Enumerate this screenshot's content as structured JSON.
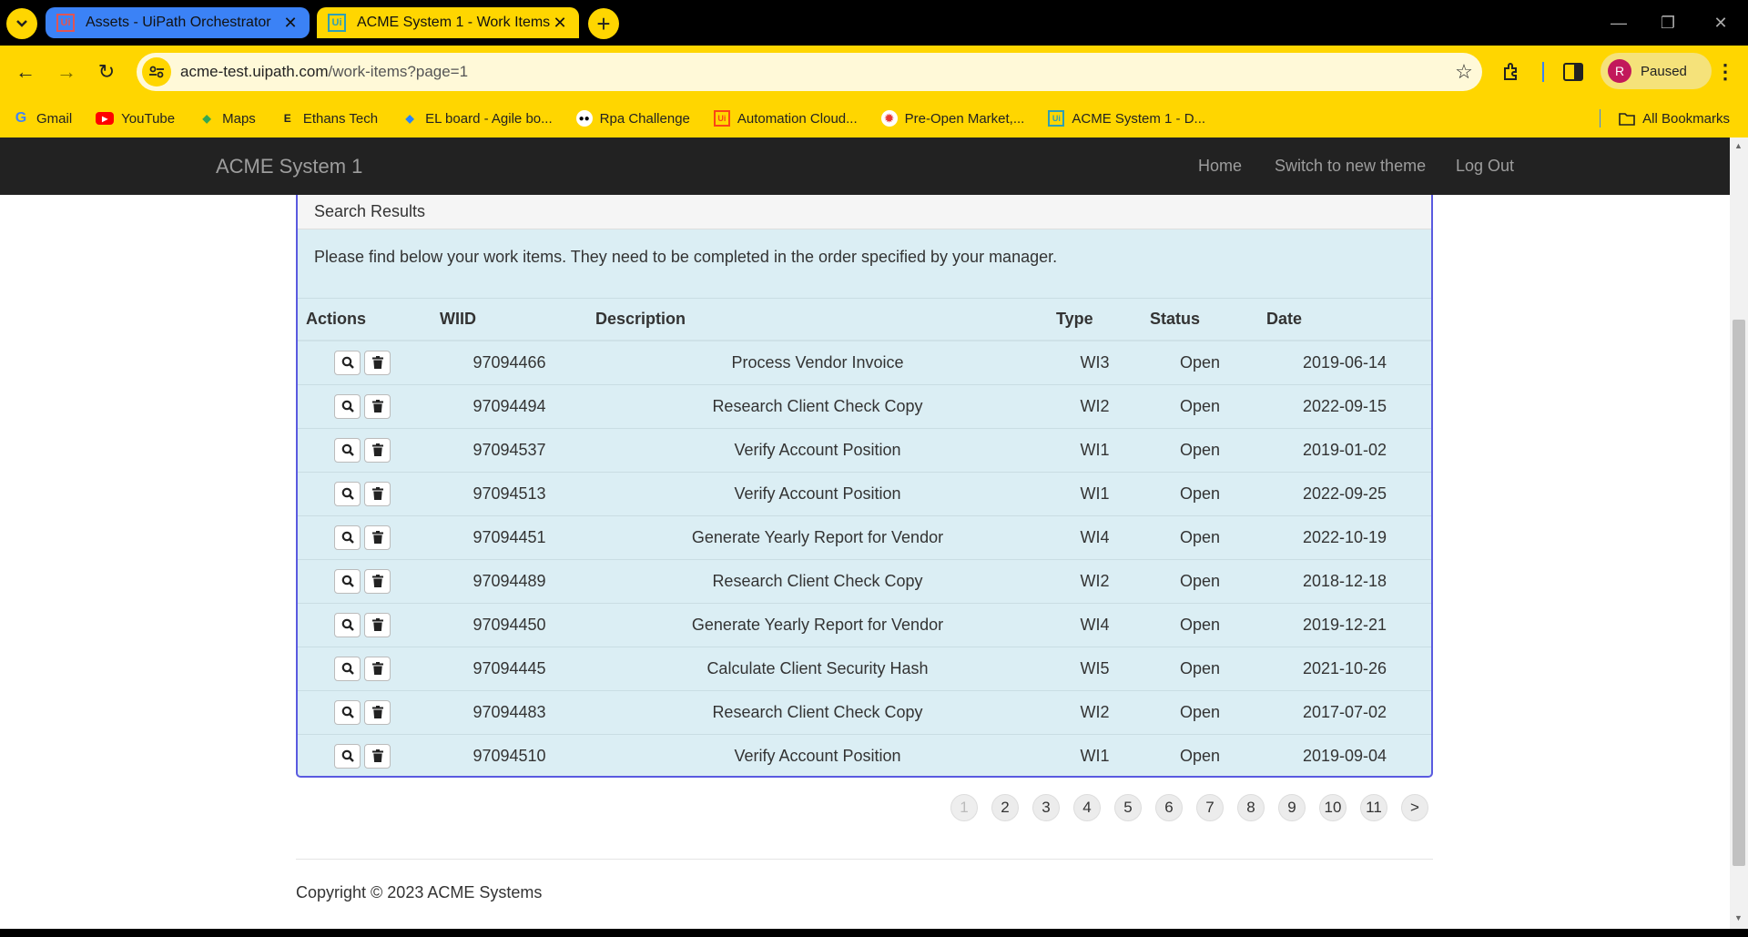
{
  "browser": {
    "tabs": [
      {
        "title": "Assets - UiPath Orchestrator",
        "favicon": "Ui",
        "active": false
      },
      {
        "title": "ACME System 1 - Work Items",
        "favicon": "Ui",
        "active": true
      }
    ],
    "url_host": "acme-test.uipath.com",
    "url_path": "/work-items?page=1",
    "profile_initial": "R",
    "profile_status": "Paused",
    "bookmarks": [
      {
        "label": "Gmail",
        "icon": "gmail-icon"
      },
      {
        "label": "YouTube",
        "icon": "youtube-icon"
      },
      {
        "label": "Maps",
        "icon": "maps-icon"
      },
      {
        "label": "Ethans Tech",
        "icon": "ethans-tech-icon"
      },
      {
        "label": "EL board - Agile bo...",
        "icon": "jira-icon"
      },
      {
        "label": "Rpa Challenge",
        "icon": "robot-icon"
      },
      {
        "label": "Automation Cloud...",
        "icon": "uipath-icon"
      },
      {
        "label": "Pre-Open Market,...",
        "icon": "nse-icon"
      },
      {
        "label": "ACME System 1 - D...",
        "icon": "uipath-icon"
      }
    ],
    "all_bookmarks": "All Bookmarks"
  },
  "app": {
    "brand": "ACME System 1",
    "nav": {
      "home": "Home",
      "switch_theme": "Switch to new theme",
      "logout": "Log Out"
    },
    "panel_title": "Search Results",
    "intro": "Please find below your work items. They need to be completed in the order specified by your manager.",
    "columns": {
      "actions": "Actions",
      "wiid": "WIID",
      "description": "Description",
      "type": "Type",
      "status": "Status",
      "date": "Date"
    },
    "rows": [
      {
        "wiid": "97094466",
        "description": "Process Vendor Invoice",
        "type": "WI3",
        "status": "Open",
        "date": "2019-06-14"
      },
      {
        "wiid": "97094494",
        "description": "Research Client Check Copy",
        "type": "WI2",
        "status": "Open",
        "date": "2022-09-15"
      },
      {
        "wiid": "97094537",
        "description": "Verify Account Position",
        "type": "WI1",
        "status": "Open",
        "date": "2019-01-02"
      },
      {
        "wiid": "97094513",
        "description": "Verify Account Position",
        "type": "WI1",
        "status": "Open",
        "date": "2022-09-25"
      },
      {
        "wiid": "97094451",
        "description": "Generate Yearly Report for Vendor",
        "type": "WI4",
        "status": "Open",
        "date": "2022-10-19"
      },
      {
        "wiid": "97094489",
        "description": "Research Client Check Copy",
        "type": "WI2",
        "status": "Open",
        "date": "2018-12-18"
      },
      {
        "wiid": "97094450",
        "description": "Generate Yearly Report for Vendor",
        "type": "WI4",
        "status": "Open",
        "date": "2019-12-21"
      },
      {
        "wiid": "97094445",
        "description": "Calculate Client Security Hash",
        "type": "WI5",
        "status": "Open",
        "date": "2021-10-26"
      },
      {
        "wiid": "97094483",
        "description": "Research Client Check Copy",
        "type": "WI2",
        "status": "Open",
        "date": "2017-07-02"
      },
      {
        "wiid": "97094510",
        "description": "Verify Account Position",
        "type": "WI1",
        "status": "Open",
        "date": "2019-09-04"
      }
    ],
    "pagination": {
      "pages": [
        "1",
        "2",
        "3",
        "4",
        "5",
        "6",
        "7",
        "8",
        "9",
        "10",
        "11"
      ],
      "current": "1",
      "next": ">"
    },
    "footer": "Copyright © 2023 ACME Systems"
  }
}
